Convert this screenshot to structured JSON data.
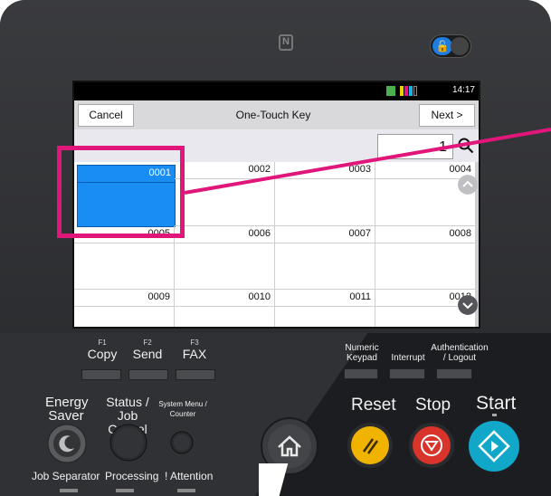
{
  "device": {
    "nfc_icon": "nfc-icon",
    "lock_icon": "lock-open-icon"
  },
  "screen": {
    "status_time": "14:17",
    "title": "One-Touch Key",
    "cancel_label": "Cancel",
    "next_label": "Next >",
    "search_value": "1",
    "keys": [
      {
        "id": "0001",
        "selected": true
      },
      {
        "id": "0002",
        "selected": false
      },
      {
        "id": "0003",
        "selected": false
      },
      {
        "id": "0004",
        "selected": false
      },
      {
        "id": "0005",
        "selected": false
      },
      {
        "id": "0006",
        "selected": false
      },
      {
        "id": "0007",
        "selected": false
      },
      {
        "id": "0008",
        "selected": false
      },
      {
        "id": "0009",
        "selected": false
      },
      {
        "id": "0010",
        "selected": false
      },
      {
        "id": "0011",
        "selected": false
      },
      {
        "id": "0012",
        "selected": false
      }
    ]
  },
  "panel": {
    "f1": {
      "fn": "F1",
      "label": "Copy"
    },
    "f2": {
      "fn": "F2",
      "label": "Send"
    },
    "f3": {
      "fn": "F3",
      "label": "FAX"
    },
    "numeric_keypad": "Numeric Keypad",
    "interrupt": "Interrupt",
    "authentication": "Authentication / Logout",
    "energy_saver": "Energy Saver",
    "status_job_cancel": "Status / Job Cancel",
    "system_menu": "System Menu / Counter",
    "reset": "Reset",
    "stop": "Stop",
    "start": "Start",
    "job_separator": "Job Separator",
    "processing": "Processing",
    "attention": "! Attention"
  },
  "colors": {
    "selected_key": "#1a8df5",
    "highlight": "#e0167a",
    "reset_button": "#f0b400",
    "stop_button": "#d9342b",
    "start_button": "#11a7c9"
  }
}
